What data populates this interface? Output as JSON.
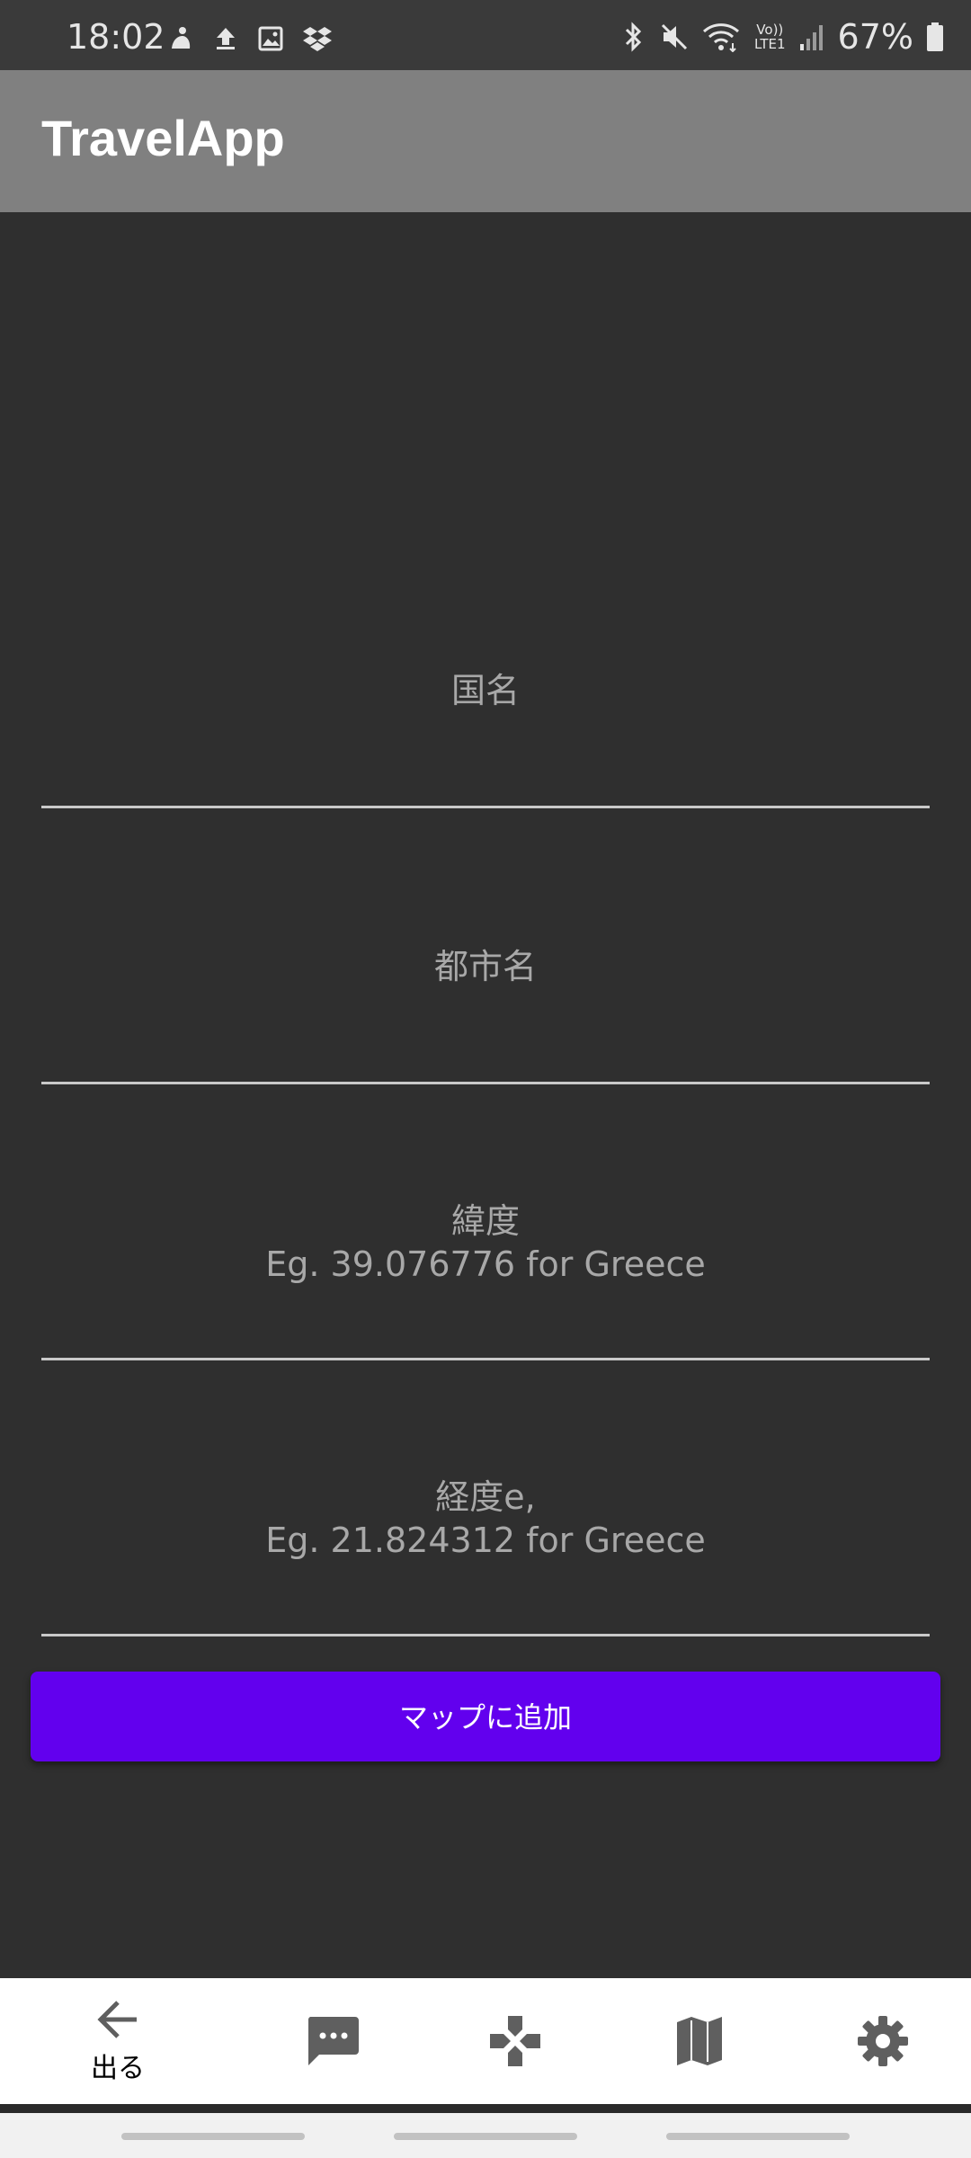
{
  "status_bar": {
    "time": "18:02",
    "battery": "67%",
    "left_icons": [
      "notification-icon",
      "upload-icon",
      "image-icon",
      "dropbox-icon"
    ],
    "right_icons": [
      "bluetooth-icon",
      "mute-icon",
      "wifi-icon",
      "volte-icon",
      "signal-icon",
      "battery-icon"
    ],
    "volte_label_top": "Vo))",
    "volte_label_bottom": "LTE1"
  },
  "app_bar": {
    "title": "TravelApp"
  },
  "form": {
    "country_hint": "国名",
    "city_hint": "都市名",
    "latitude_hint_line1": "緯度",
    "latitude_hint_line2": "Eg. 39.076776 for Greece",
    "longitude_hint_line1": "経度e,",
    "longitude_hint_line2": "Eg. 21.824312 for Greece",
    "submit_label": "マップに追加"
  },
  "bottom_nav": {
    "items": [
      {
        "icon": "back-arrow-icon",
        "label": "出る"
      },
      {
        "icon": "chat-icon",
        "label": ""
      },
      {
        "icon": "gamepad-icon",
        "label": ""
      },
      {
        "icon": "map-icon",
        "label": ""
      },
      {
        "icon": "settings-icon",
        "label": ""
      }
    ]
  },
  "colors": {
    "background": "#2f2f2f",
    "app_bar": "#808080",
    "accent": "#6200ee",
    "hint_text": "#a8a8a8",
    "nav_icon": "#5f5f5f"
  }
}
